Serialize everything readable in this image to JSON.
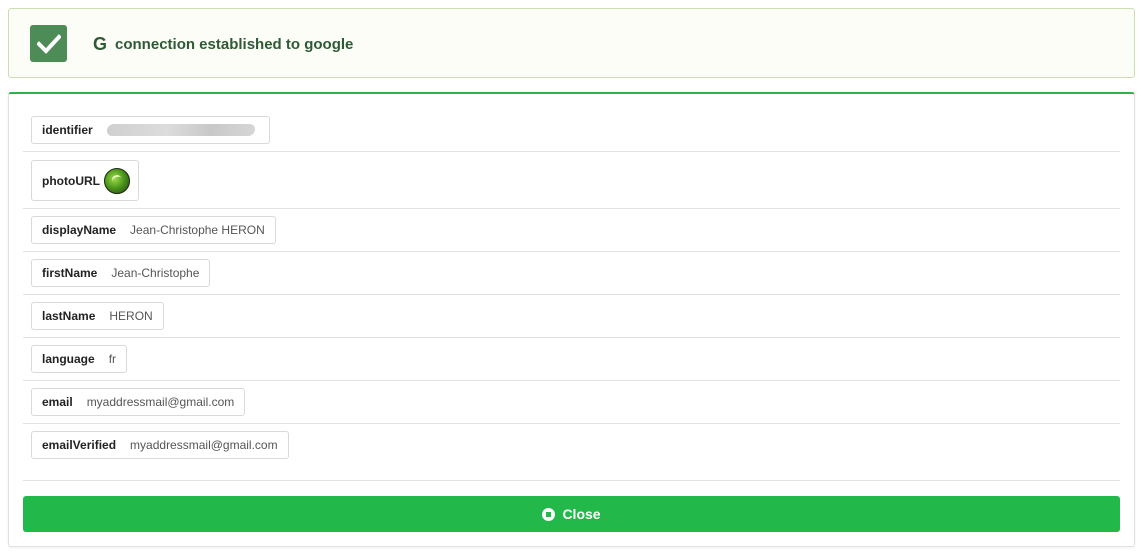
{
  "alert": {
    "icon": "check-icon",
    "provider_icon": "google-g-icon",
    "provider_glyph": "G",
    "message": "connection established to google",
    "accent": "#4e8c57"
  },
  "profile": {
    "fields": [
      {
        "key": "identifier",
        "value": ""
      },
      {
        "key": "photoURL",
        "value": ""
      },
      {
        "key": "displayName",
        "value": "Jean-Christophe HERON"
      },
      {
        "key": "firstName",
        "value": "Jean-Christophe"
      },
      {
        "key": "lastName",
        "value": "HERON"
      },
      {
        "key": "language",
        "value": "fr"
      },
      {
        "key": "email",
        "value": "myaddressmail@gmail.com"
      },
      {
        "key": "emailVerified",
        "value": "myaddressmail@gmail.com"
      }
    ]
  },
  "actions": {
    "close_label": "Close",
    "close_icon": "stop-circle-icon",
    "close_color": "#23b84a"
  }
}
